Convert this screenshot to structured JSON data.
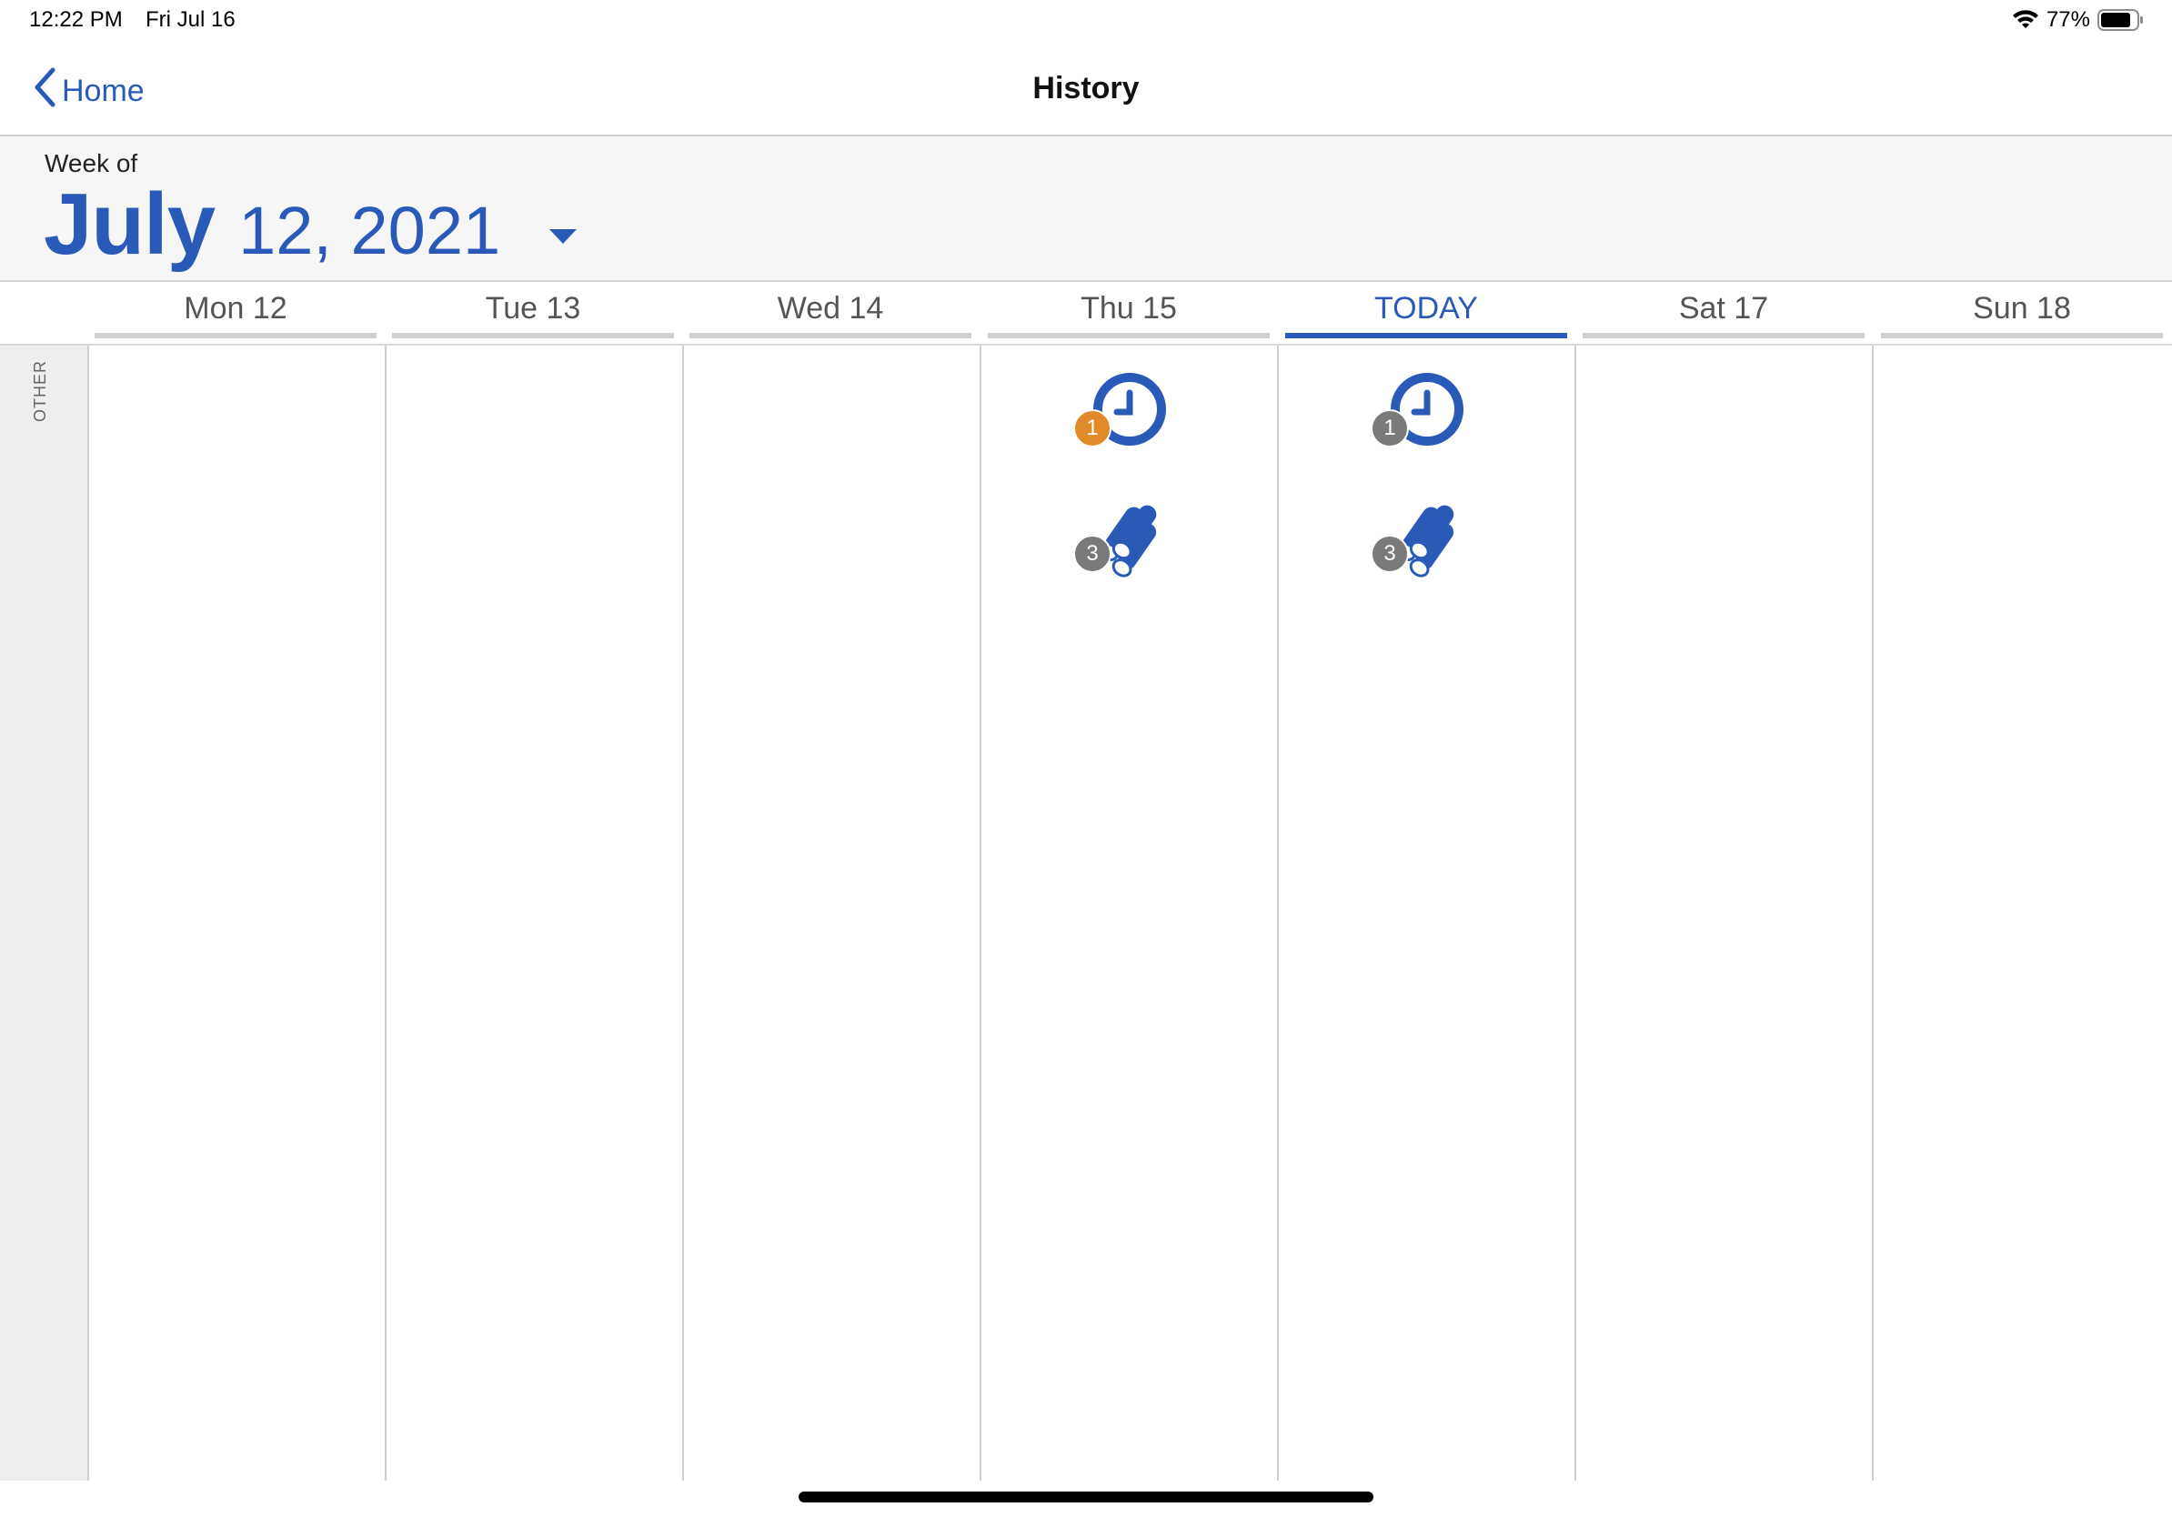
{
  "status_bar": {
    "time": "12:22 PM",
    "date": "Fri Jul 16",
    "battery": "77%"
  },
  "nav": {
    "back_label": "Home",
    "title": "History"
  },
  "week_header": {
    "label": "Week of",
    "month": "July",
    "rest": "12, 2021"
  },
  "side": {
    "label": "OTHER"
  },
  "days": [
    {
      "label": "Mon 12"
    },
    {
      "label": "Tue 13"
    },
    {
      "label": "Wed 14"
    },
    {
      "label": "Thu 15"
    },
    {
      "label": "TODAY"
    },
    {
      "label": "Sat 17"
    },
    {
      "label": "Sun 18"
    }
  ],
  "events": {
    "thu": {
      "clock_badge": "1",
      "logs_badge": "3"
    },
    "today": {
      "clock_badge": "1",
      "logs_badge": "3"
    }
  },
  "colors": {
    "accent": "#2a5ab8",
    "badge_orange": "#e08a2a",
    "badge_gray": "#7a7a7a"
  }
}
